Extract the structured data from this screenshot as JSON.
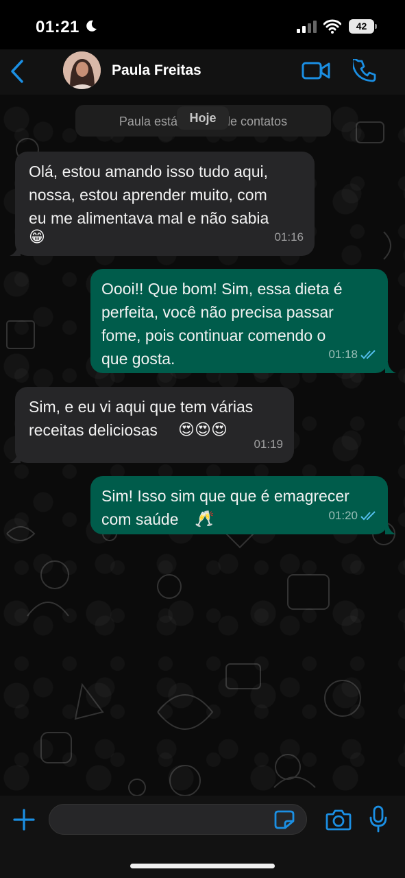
{
  "status_bar": {
    "time": "01:21",
    "battery": "42"
  },
  "header": {
    "contact_name": "Paula Freitas",
    "accent": "#1b8fe3"
  },
  "system": {
    "contacts_note": "Paula está na lista de contatos",
    "date_label": "Hoje"
  },
  "messages": [
    {
      "direction": "in",
      "text": "Olá, estou amando isso tudo aqui,\nnossa, estou aprender muito, com\neu me alimentava mal e não sabia",
      "emoji": "😁",
      "time": "01:16"
    },
    {
      "direction": "out",
      "text": "Oooi!! Que bom! Sim, essa dieta é\nperfeita, você não precisa passar\nfome, pois continuar comendo o\nque gosta.",
      "time": "01:18",
      "status": "read"
    },
    {
      "direction": "in",
      "text": "Sim, e eu vi aqui que tem várias\nreceitas deliciosas",
      "emoji": "😍😍😍",
      "time": "01:19"
    },
    {
      "direction": "out",
      "text": "Sim! Isso sim que que é emagrecer\ncom saúde",
      "emoji": "🥂",
      "time": "01:20",
      "status": "read"
    }
  ],
  "composer": {
    "placeholder": ""
  },
  "colors": {
    "incoming_bubble": "#262628",
    "outgoing_bubble": "#005c4b",
    "read_ticks": "#53bdeb"
  },
  "icons": [
    "moon-icon",
    "signal-icon",
    "wifi-icon",
    "battery-icon",
    "back-chevron-icon",
    "video-call-icon",
    "phone-icon",
    "plus-icon",
    "sticker-icon",
    "camera-icon",
    "microphone-icon"
  ]
}
